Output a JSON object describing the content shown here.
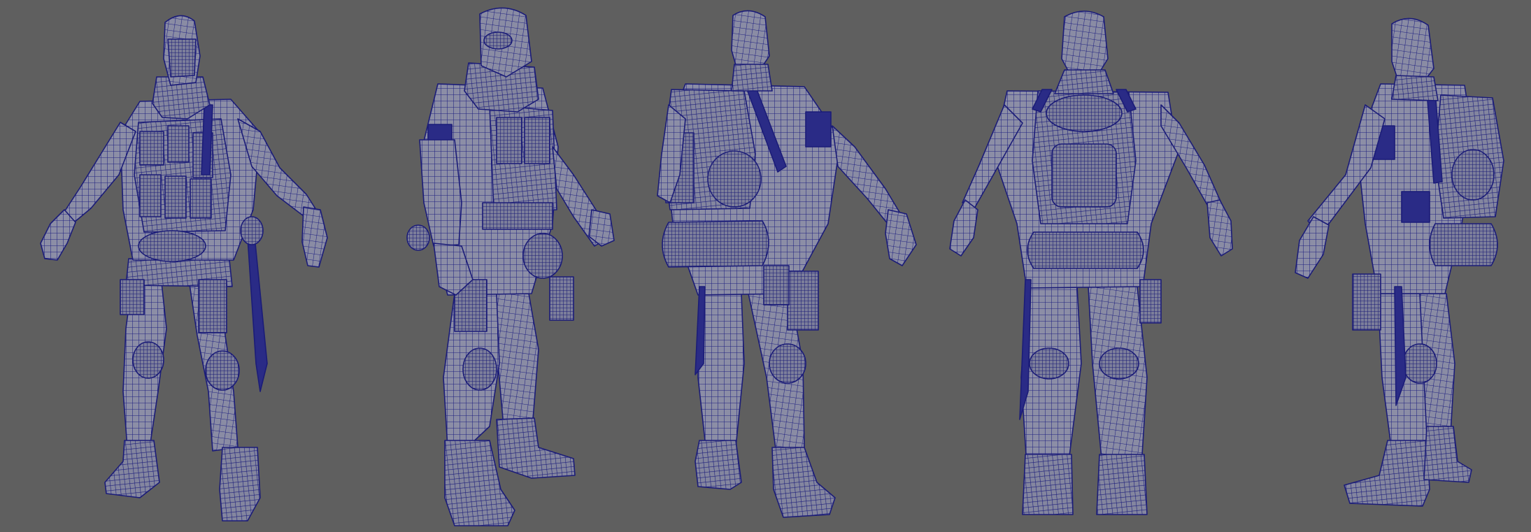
{
  "viewport": {
    "background_color": "#5f5f5f",
    "wireframe_color": "#1b1c78",
    "surface_color": "#8c8ea6"
  },
  "views": [
    {
      "id": "front-three-quarter"
    },
    {
      "id": "left-side"
    },
    {
      "id": "back-three-quarter"
    },
    {
      "id": "back"
    },
    {
      "id": "right-back-side"
    }
  ]
}
